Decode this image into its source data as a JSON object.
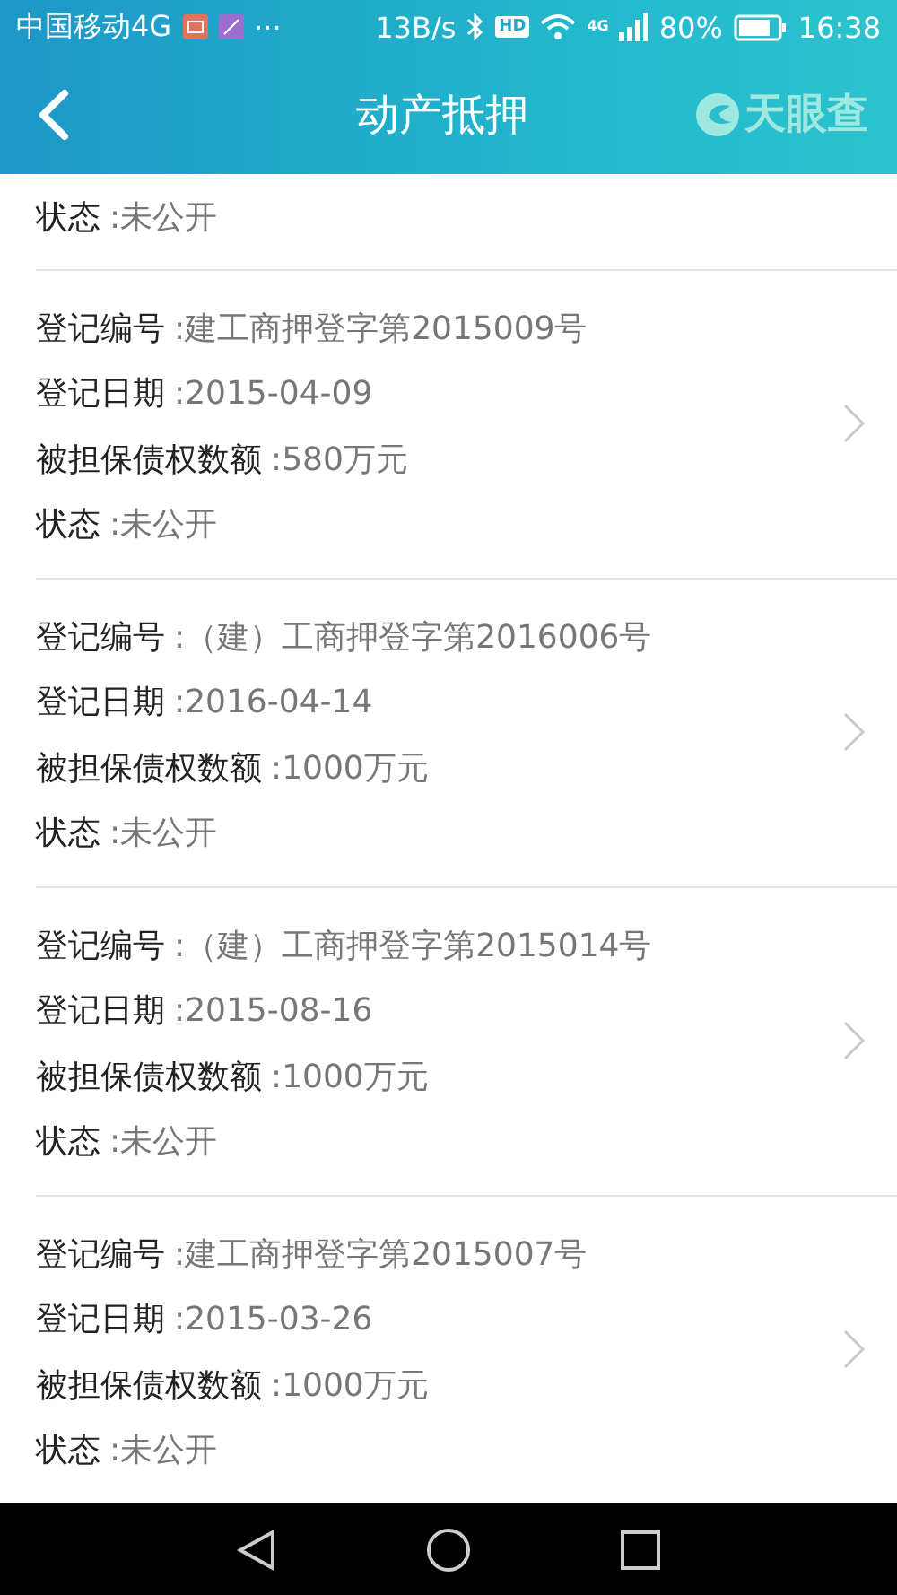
{
  "status_bar": {
    "carrier": "中国移动4G",
    "more": "···",
    "speed": "13B/s",
    "hd": "HD",
    "network": "4G",
    "battery": "80%",
    "time": "16:38"
  },
  "header": {
    "title": "动产抵押",
    "logo": "天眼查"
  },
  "partial_record": {
    "fields": [
      {
        "label": "状态",
        "value": ":未公开"
      }
    ]
  },
  "records": [
    {
      "fields": [
        {
          "label": "登记编号",
          "value": ":建工商押登字第2015009号"
        },
        {
          "label": "登记日期",
          "value": ":2015-04-09"
        },
        {
          "label": "被担保债权数额",
          "value": ":580万元"
        },
        {
          "label": "状态",
          "value": ":未公开"
        }
      ]
    },
    {
      "fields": [
        {
          "label": "登记编号",
          "value": ":（建）工商押登字第2016006号"
        },
        {
          "label": "登记日期",
          "value": ":2016-04-14"
        },
        {
          "label": "被担保债权数额",
          "value": ":1000万元"
        },
        {
          "label": "状态",
          "value": ":未公开"
        }
      ]
    },
    {
      "fields": [
        {
          "label": "登记编号",
          "value": ":（建）工商押登字第2015014号"
        },
        {
          "label": "登记日期",
          "value": ":2015-08-16"
        },
        {
          "label": "被担保债权数额",
          "value": ":1000万元"
        },
        {
          "label": "状态",
          "value": ":未公开"
        }
      ]
    },
    {
      "fields": [
        {
          "label": "登记编号",
          "value": ":建工商押登字第2015007号"
        },
        {
          "label": "登记日期",
          "value": ":2015-03-26"
        },
        {
          "label": "被担保债权数额",
          "value": ":1000万元"
        },
        {
          "label": "状态",
          "value": ":未公开"
        }
      ]
    }
  ]
}
